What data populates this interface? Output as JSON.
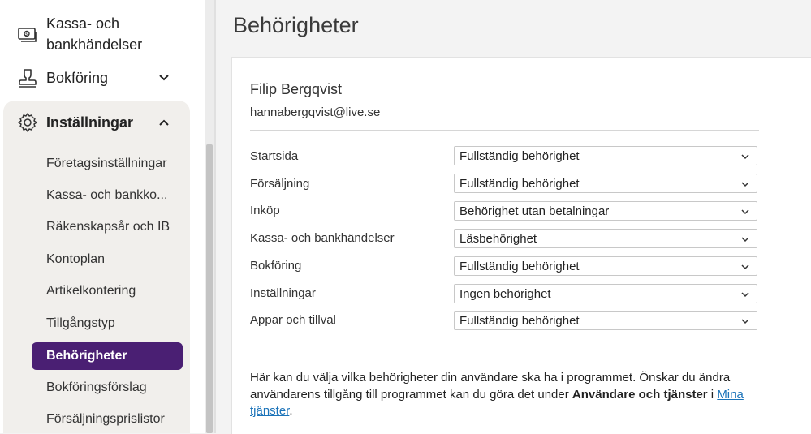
{
  "sidebar": {
    "top_items": [
      {
        "label_line1": "Kassa- och",
        "label_line2": "bankhändelser",
        "icon": "cash-register-icon"
      },
      {
        "label": "Bokföring",
        "icon": "stamp-icon"
      },
      {
        "label": "Inställningar",
        "icon": "gear-icon"
      }
    ],
    "sub_items": [
      {
        "label": "Företagsinställningar"
      },
      {
        "label": "Kassa- och bankko..."
      },
      {
        "label": "Räkenskapsår och IB"
      },
      {
        "label": "Kontoplan"
      },
      {
        "label": "Artikelkontering"
      },
      {
        "label": "Tillgångstyp"
      },
      {
        "label": "Behörigheter"
      },
      {
        "label": "Bokföringsförslag"
      },
      {
        "label": "Försäljningsprislistor"
      }
    ]
  },
  "main": {
    "title": "Behörigheter",
    "user": {
      "name": "Filip Bergqvist",
      "email": "hannabergqvist@live.se"
    },
    "permissions": [
      {
        "area": "Startsida",
        "value": "Fullständig behörighet"
      },
      {
        "area": "Försäljning",
        "value": "Fullständig behörighet"
      },
      {
        "area": "Inköp",
        "value": "Behörighet utan betalningar"
      },
      {
        "area": "Kassa- och bankhändelser",
        "value": "Läsbehörighet"
      },
      {
        "area": "Bokföring",
        "value": "Fullständig behörighet"
      },
      {
        "area": "Inställningar",
        "value": "Ingen behörighet"
      },
      {
        "area": "Appar och tillval",
        "value": "Fullständig behörighet"
      }
    ],
    "help": {
      "text_before": "Här kan du välja vilka behörigheter din användare ska ha i programmet. Önskar du ändra användarens tillgång till programmet kan du göra det under ",
      "bold": "Användare och tjänster",
      "text_mid": " i ",
      "link": "Mina tjänster",
      "text_after": "."
    }
  },
  "colors": {
    "accent": "#4a1f73",
    "link": "#1b73b9",
    "settings_bg": "#f1efec"
  }
}
